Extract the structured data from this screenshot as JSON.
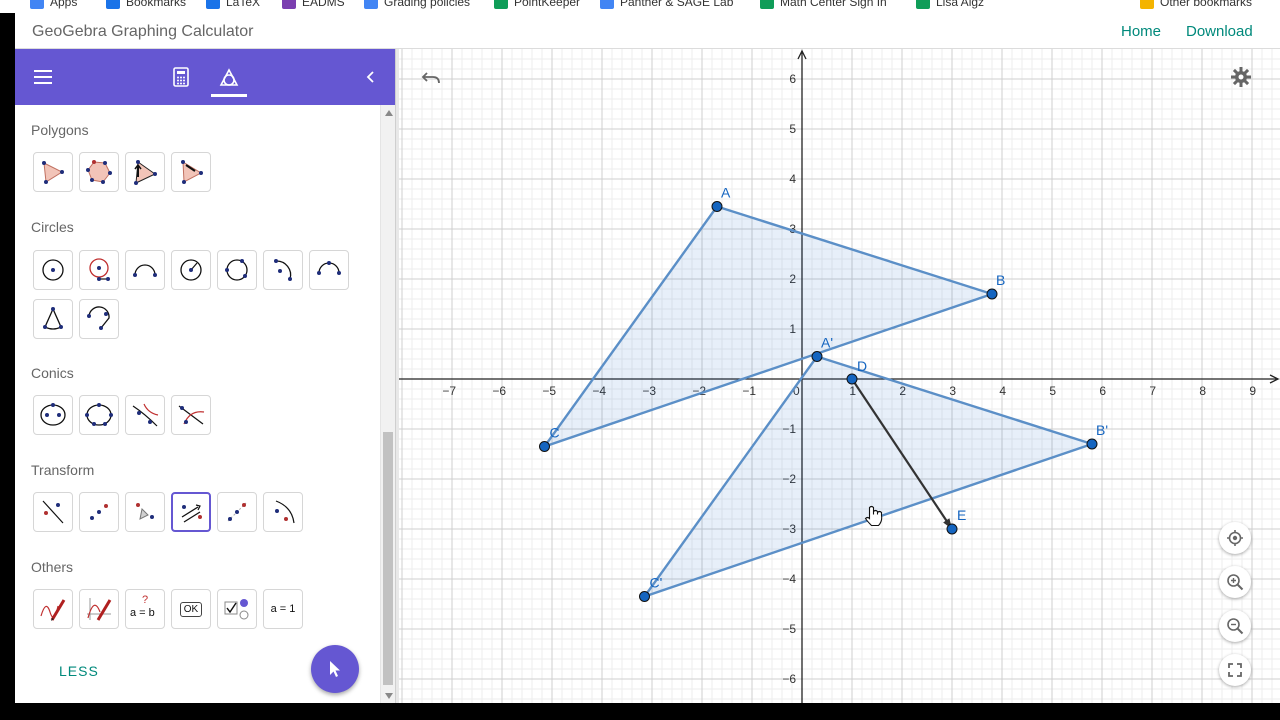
{
  "bookmarks": [
    {
      "label": "Apps",
      "color": "#4285f4"
    },
    {
      "label": "Bookmarks",
      "color": "#1a73e8"
    },
    {
      "label": "LaTeX",
      "color": "#1a73e8"
    },
    {
      "label": "EADMS",
      "color": "#7b3fb0"
    },
    {
      "label": "Grading policies",
      "color": "#4285f4"
    },
    {
      "label": "PointKeeper",
      "color": "#0f9d58"
    },
    {
      "label": "Panther & SAGE Lab",
      "color": "#4285f4"
    },
    {
      "label": "Math Center Sign In",
      "color": "#0f9d58"
    },
    {
      "label": "Lisa Algz",
      "color": "#0f9d58"
    },
    {
      "label": "Other bookmarks",
      "color": "#f4b400"
    }
  ],
  "header": {
    "title": "GeoGebra Graphing Calculator",
    "home": "Home",
    "download": "Download"
  },
  "toolbar": {
    "menu_icon": "menu-icon",
    "algebra_tab_icon": "calculator-icon",
    "tools_tab_icon": "geometry-tools-icon",
    "collapse_icon": "chevron-left-icon",
    "accent": "#6557d2"
  },
  "tools": {
    "sections": [
      {
        "title": "Polygons",
        "icons": [
          "polygon-icon",
          "regular-polygon-icon",
          "vector-polygon-icon",
          "rigid-polygon-icon"
        ]
      },
      {
        "title": "Circles",
        "icons": [
          "circle-center-point-icon",
          "circle-radius-icon",
          "semicircle-icon",
          "compass-icon",
          "circle-three-points-icon",
          "circular-arc-icon",
          "circumcircular-arc-icon",
          "circular-sector-icon",
          "circumcircular-sector-icon"
        ]
      },
      {
        "title": "Conics",
        "icons": [
          "ellipse-icon",
          "conic-five-points-icon",
          "hyperbola-icon",
          "parabola-icon"
        ]
      },
      {
        "title": "Transform",
        "icons": [
          "reflect-line-icon",
          "reflect-point-icon",
          "rotate-point-icon",
          "translate-vector-icon",
          "dilate-icon",
          "reflect-circle-icon"
        ]
      },
      {
        "title": "Others",
        "icons": [
          "pen-icon",
          "freehand-function-icon",
          "relation-icon",
          "button-icon",
          "checkbox-icon",
          "slider-icon"
        ]
      }
    ],
    "selected_tool": "translate-vector-icon",
    "relation_label": "a = b",
    "button_label": "OK",
    "slider_label": "a = 1",
    "less_label": "LESS"
  },
  "graph": {
    "x_ticks": [
      "−7",
      "−6",
      "−5",
      "−4",
      "−3",
      "−2",
      "−1",
      "0",
      "1",
      "2",
      "3",
      "4",
      "5",
      "6",
      "7",
      "8",
      "9"
    ],
    "y_ticks": [
      "6",
      "5",
      "4",
      "3",
      "2",
      "1",
      "−1",
      "−2",
      "−3",
      "−4",
      "−5",
      "−6"
    ],
    "points": [
      {
        "name": "A",
        "x": -1.7,
        "y": 3.45
      },
      {
        "name": "B",
        "x": 3.8,
        "y": 1.7
      },
      {
        "name": "C",
        "x": -5.15,
        "y": -1.35
      },
      {
        "name": "A'",
        "x": 0.3,
        "y": 0.45
      },
      {
        "name": "B'",
        "x": 5.8,
        "y": -1.3
      },
      {
        "name": "C'",
        "x": -3.15,
        "y": -4.35
      },
      {
        "name": "D",
        "x": 1,
        "y": 0
      },
      {
        "name": "E",
        "x": 3,
        "y": -3
      }
    ],
    "polygons": [
      [
        "A",
        "B",
        "C"
      ],
      [
        "A'",
        "B'",
        "C'"
      ]
    ],
    "vector": {
      "from": "D",
      "to": "E"
    },
    "colors": {
      "polygon": "#1565c0",
      "point": "#1565c0",
      "vector": "#333333",
      "label": "#1565c0"
    }
  },
  "graph_controls": {
    "undo_icon": "undo-icon",
    "settings_icon": "gear-icon",
    "home_view_icon": "locate-icon",
    "zoom_in_icon": "zoom-in-icon",
    "zoom_out_icon": "zoom-out-icon",
    "fullscreen_icon": "fullscreen-icon"
  }
}
